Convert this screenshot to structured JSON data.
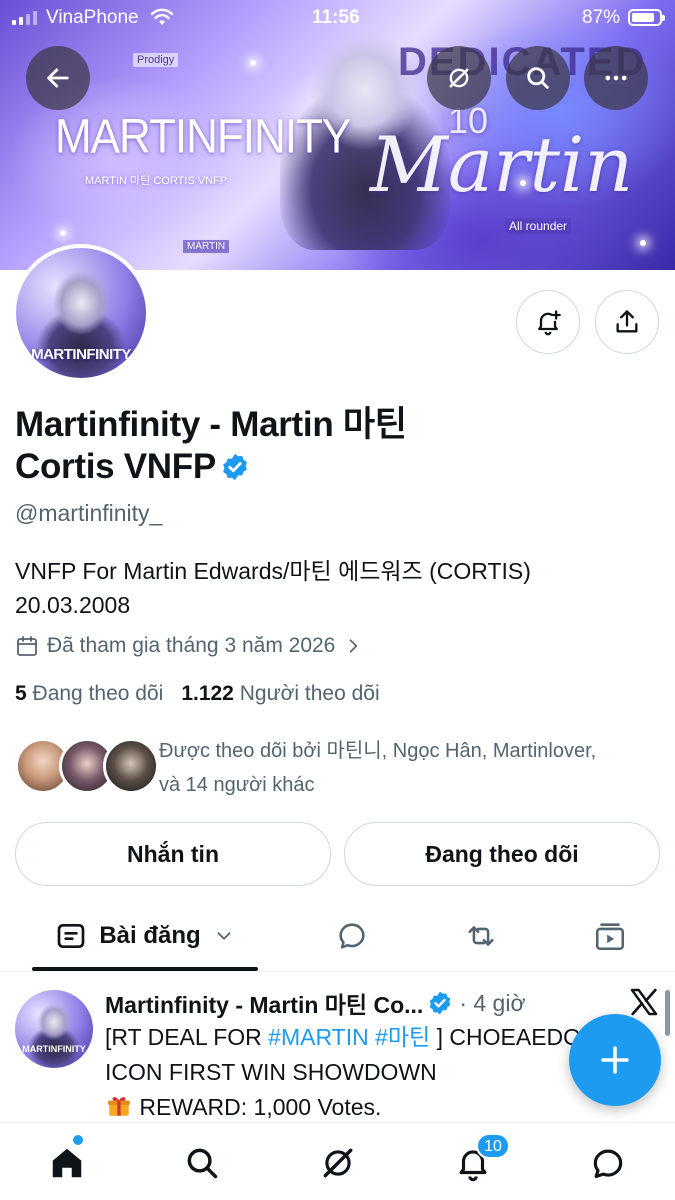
{
  "status_bar": {
    "carrier": "VinaPhone",
    "time": "11:56",
    "battery": "87%"
  },
  "banner": {
    "title": "MARTINFINITY",
    "subtitle": "MARTIN 마틴 CORTIS VNFP",
    "tag_prodigy": "Prodigy",
    "tag_martin": "MARTIN",
    "tag_all_rounder": "All rounder",
    "script_text": "Martin",
    "dedicated": "DEDICATED",
    "number": "10"
  },
  "avatar": {
    "text": "MARTINFINITY"
  },
  "profile": {
    "name_line1": "Martinfinity - Martin 마틴",
    "name_line2": "Cortis VNFP",
    "handle": "@martinfinity_",
    "bio_line1": "VNFP For Martin Edwards/마틴 에드워즈 (CORTIS)",
    "bio_line2": "20.03.2008",
    "joined": "Đã tham gia tháng 3 năm 2026",
    "following_count": "5",
    "following_label": "Đang theo dõi",
    "followers_count": "1.122",
    "followers_label": "Người theo dõi",
    "followed_by_line1": "Được theo dõi bởi 마틴니, Ngọc Hân, Martinlover,",
    "followed_by_line2": "và 14 người khác"
  },
  "buttons": {
    "message": "Nhắn tin",
    "following": "Đang theo dõi"
  },
  "tabs": {
    "posts": "Bài đăng"
  },
  "post": {
    "author": "Martinfinity - Martin 마틴 Co...",
    "time": "· 4 giờ",
    "line1_prefix": "[RT DEAL FOR ",
    "hashtag1": "#MARTIN",
    "hashtag2": "#마틴",
    "line1_suffix": " ] CHOEAEDOL",
    "line2": "ICON FIRST WIN SHOWDOWN",
    "line3": "REWARD: 1,000 Votes."
  },
  "bottom_nav": {
    "notification_count": "10"
  },
  "colors": {
    "accent": "#1d9bf0",
    "text": "#0f1419",
    "secondary": "#536471"
  }
}
